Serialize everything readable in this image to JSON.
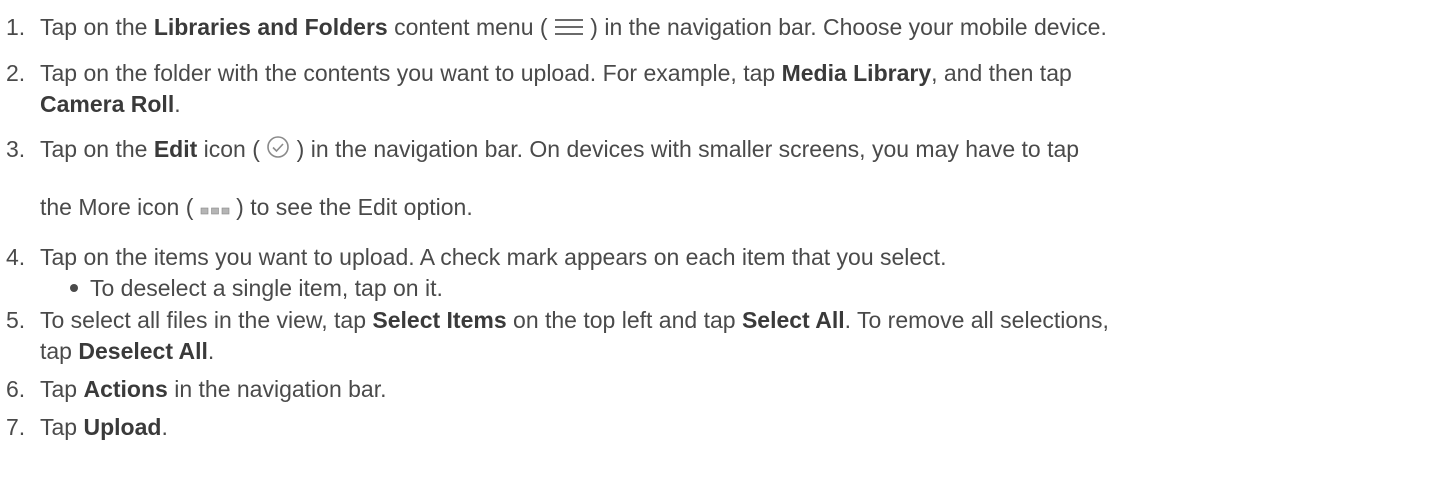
{
  "steps": [
    {
      "num": "1.",
      "a": "Tap on the ",
      "b1": "Libraries and Folders",
      "c": " content menu ( ",
      "icon": "hamburger-menu-icon",
      "d": " ) in the navigation bar. Choose your mobile device."
    },
    {
      "num": "2.",
      "a": "Tap on the folder with the contents you want to upload. For example, tap ",
      "b1": "Media Library",
      "c": ", and then tap",
      "b2": "Camera Roll",
      "d": "."
    },
    {
      "num": "3.",
      "a": "Tap on the ",
      "b1": "Edit",
      "c": " icon ( ",
      "icon": "checkmark-circle-icon",
      "d": " ) in the navigation bar. On devices with smaller screens, you may have to tap",
      "e": "the More icon ( ",
      "icon2": "more-dots-icon",
      "f": " ) to see the Edit option."
    },
    {
      "num": "4.",
      "a": "Tap on the items you want to upload. A check mark appears on each item that you select.",
      "bullet": "To deselect a single item, tap on it."
    },
    {
      "num": "5.",
      "a": "To select all files in the view, tap ",
      "b1": "Select Items",
      "c": " on the top left and tap ",
      "b2": "Select All",
      "d": ". To remove all selections,",
      "e": "tap ",
      "b3": "Deselect All",
      "f": "."
    },
    {
      "num": "6.",
      "a": "Tap ",
      "b1": "Actions",
      "c": " in the navigation bar."
    },
    {
      "num": "7.",
      "a": "Tap ",
      "b1": "Upload",
      "c": "."
    }
  ]
}
